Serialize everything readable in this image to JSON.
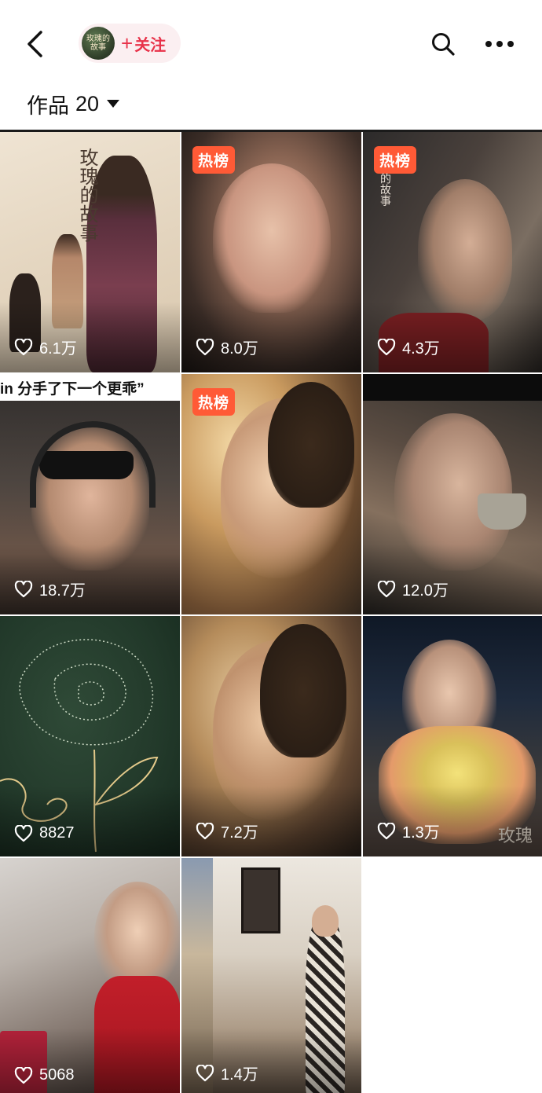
{
  "header": {
    "avatar_text": "玫瑰的故事",
    "follow_label": "关注",
    "back_icon": "chevron-left-icon",
    "search_icon": "search-icon",
    "more_icon": "more-horizontal-icon",
    "follow_color": "#e8334a"
  },
  "works": {
    "label": "作品",
    "count": "20"
  },
  "badge_color": "#ff5a36",
  "tiles": [
    {
      "likes": "6.1万",
      "hot": "",
      "overlay": "玫瑰的故事"
    },
    {
      "likes": "8.0万",
      "hot": "热榜",
      "overlay": ""
    },
    {
      "likes": "4.3万",
      "hot": "热榜",
      "overlay": "的故事"
    },
    {
      "likes": "18.7万",
      "hot": "",
      "overlay": "in 分手了下一个更乖”"
    },
    {
      "likes": "",
      "hot": "热榜",
      "overlay": ""
    },
    {
      "likes": "12.0万",
      "hot": "",
      "overlay": ""
    },
    {
      "likes": "8827",
      "hot": "",
      "overlay": ""
    },
    {
      "likes": "7.2万",
      "hot": "",
      "overlay": ""
    },
    {
      "likes": "1.3万",
      "hot": "",
      "overlay": "玫瑰"
    },
    {
      "likes": "5068",
      "hot": "",
      "overlay": ""
    },
    {
      "likes": "1.4万",
      "hot": "",
      "overlay": ""
    }
  ]
}
